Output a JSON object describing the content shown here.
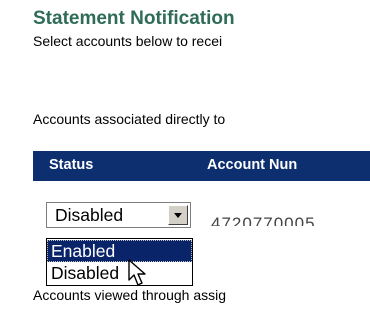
{
  "header": {
    "title": "Statement Notification",
    "subtitle": "Select accounts below to recei"
  },
  "section": {
    "direct_label": "Accounts associated directly to",
    "assigned_label": "Accounts viewed through assig"
  },
  "table": {
    "columns": [
      "Status",
      "Account Nun"
    ],
    "rows": [
      {
        "status": "Disabled",
        "account_number": "4720770005"
      }
    ]
  },
  "dropdown": {
    "selected": "Disabled",
    "options": [
      "Enabled",
      "Disabled"
    ],
    "highlighted": "Enabled"
  },
  "colors": {
    "title": "#2f6b57",
    "header_bg": "#0e2f6f",
    "highlight": "#0a246a"
  },
  "icons": {
    "arrow": "chevron-down-icon",
    "cursor": "mouse-pointer-icon"
  }
}
